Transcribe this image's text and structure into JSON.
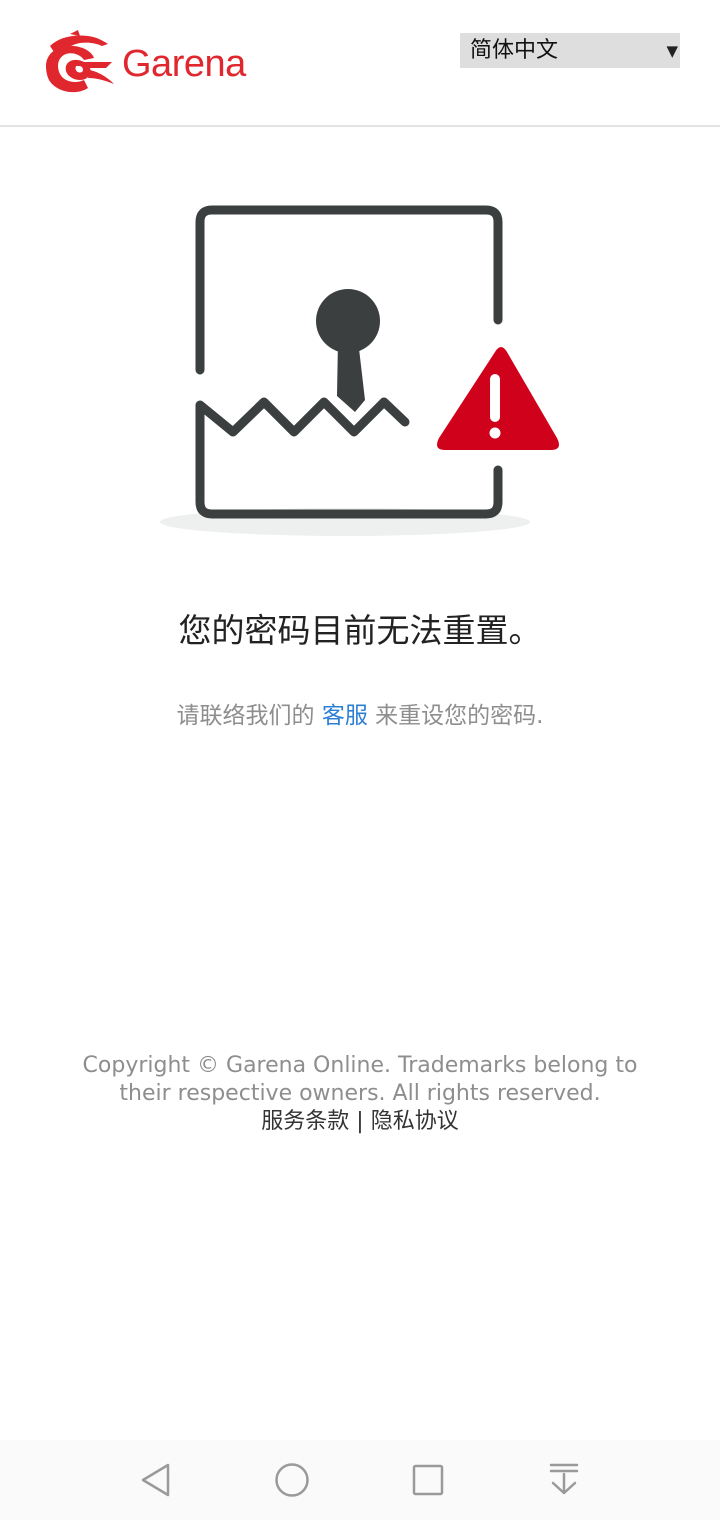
{
  "header": {
    "logo_text": "Garena",
    "language": {
      "selected": "简体中文",
      "arrow": "▼"
    }
  },
  "illustration": {
    "icons": [
      "broken-lock-frame-icon",
      "keyhole-icon",
      "warning-triangle-icon"
    ],
    "colors": {
      "frame": "#3b3f3f",
      "warning": "#d0021b",
      "shadow": "#edf0ee"
    }
  },
  "main": {
    "title": "您的密码目前无法重置。",
    "message_before": "请联络我们的",
    "message_link": "客服",
    "message_after": "来重设您的密码."
  },
  "footer": {
    "copyright": "Copyright © Garena Online. Trademarks belong to their respective owners. All rights reserved.",
    "terms": "服务条款",
    "separator": "|",
    "privacy": "隐私协议"
  },
  "nav_bar": {
    "buttons": [
      "back-icon",
      "home-icon",
      "recents-icon",
      "notification-pull-icon"
    ]
  },
  "colors": {
    "brand": "#e0272e",
    "link": "#2d7fd4",
    "muted_text": "#8e8e8e"
  }
}
